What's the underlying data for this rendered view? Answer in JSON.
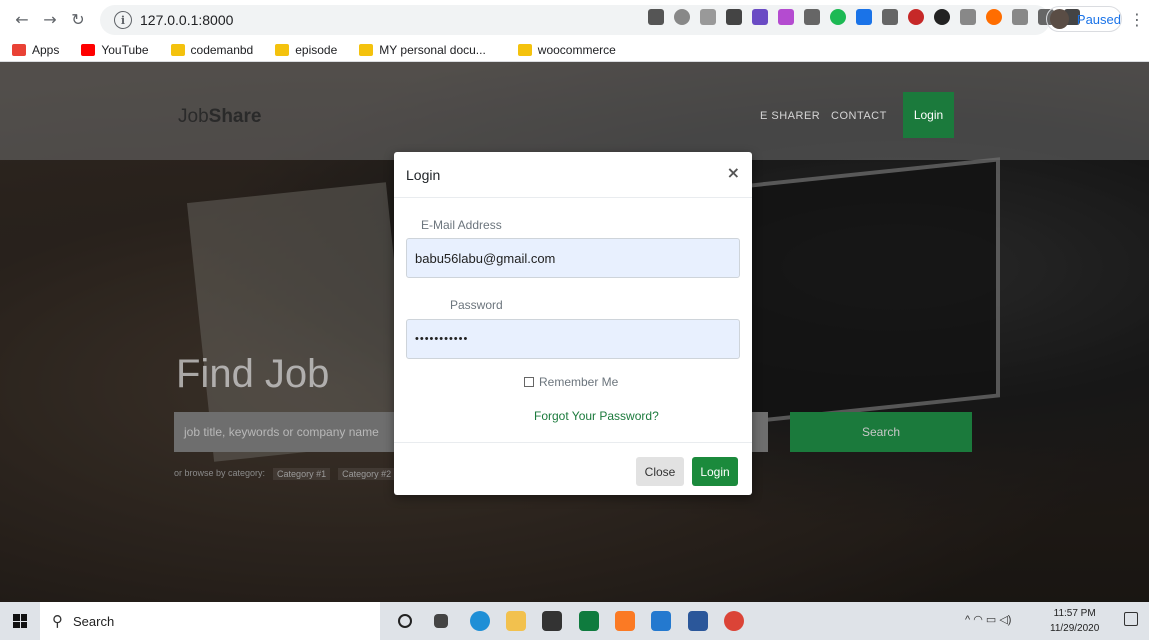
{
  "browser": {
    "url": "127.0.0.1:8000",
    "profile_label": "Paused",
    "bookmarks": [
      {
        "label": "Apps",
        "color": "#e94235"
      },
      {
        "label": "YouTube",
        "color": "#ff0000"
      },
      {
        "label": "codemanbd",
        "color": "#f4c20d"
      },
      {
        "label": "episode",
        "color": "#f4c20d"
      },
      {
        "label": "MY personal docu...",
        "color": "#f4c20d"
      },
      {
        "label": "woocommerce",
        "color": "#f4c20d"
      }
    ]
  },
  "site": {
    "brand_light": "Job",
    "brand_bold": "Share",
    "nav": [
      "E SHARER",
      "CONTACT"
    ],
    "login_label": "Login",
    "hero_title": "Find Job",
    "search_placeholder": "job title, keywords or company name",
    "search_button": "Search",
    "browse_label": "or browse by category:",
    "categories": [
      "Category #1",
      "Category #2"
    ]
  },
  "modal": {
    "title": "Login",
    "close_symbol": "×",
    "email_label": "E-Mail Address",
    "email_value": "babu56labu@gmail.com",
    "password_label": "Password",
    "password_value": "•••••••••••",
    "remember_label": "Remember Me",
    "forgot_label": "Forgot Your Password?",
    "close_button": "Close",
    "login_button": "Login"
  },
  "taskbar": {
    "search_text": "Search",
    "time": "11:57 PM",
    "date": "11/29/2020"
  },
  "colors": {
    "accent_green": "#1b7a3c",
    "field_fill": "#e8f0fe"
  }
}
